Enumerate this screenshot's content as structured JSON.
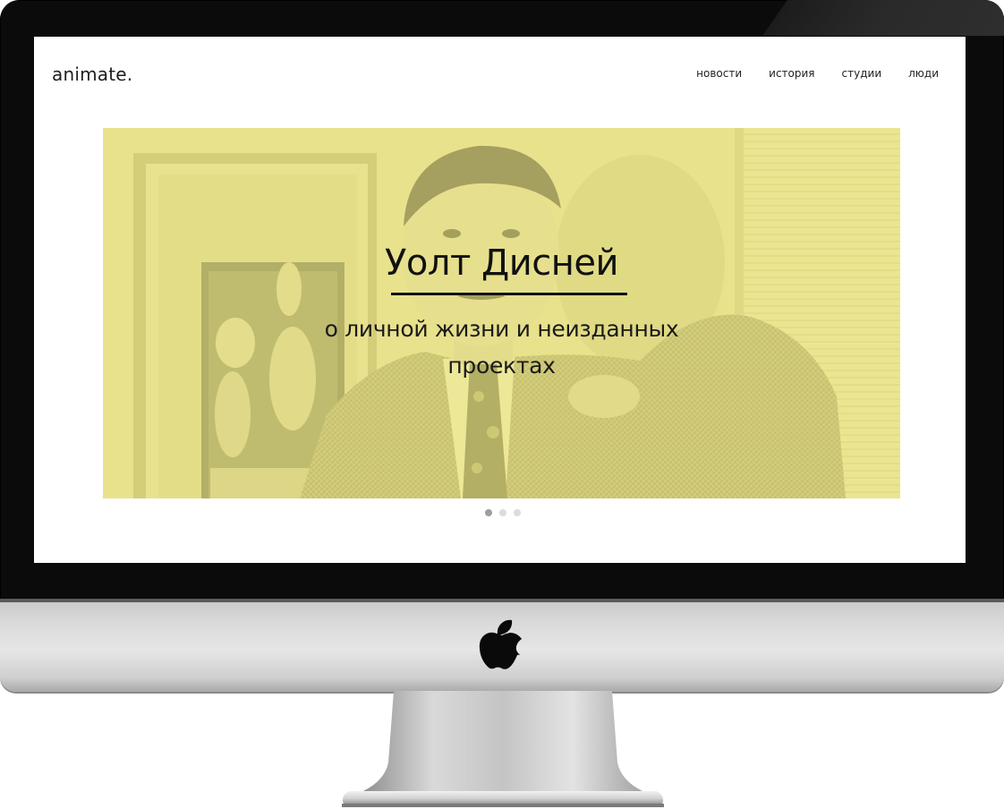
{
  "site": {
    "logo": "animate."
  },
  "nav": {
    "items": [
      {
        "label": "новости"
      },
      {
        "label": "история"
      },
      {
        "label": "студии"
      },
      {
        "label": "люди"
      }
    ]
  },
  "hero": {
    "title": "Уолт Дисней",
    "subtitle_line1": "о личной жизни и неизданных",
    "subtitle_line2": "проектах",
    "tint_color": "#ece88c"
  },
  "carousel": {
    "slide_count": 3,
    "active_index": 0
  },
  "colors": {
    "bezel": "#0b0b0b",
    "chin": "#d9d9d9",
    "screen_bg": "#ffffff",
    "text": "#1e1e1e"
  },
  "icons": {
    "brand": "apple-logo-icon"
  }
}
